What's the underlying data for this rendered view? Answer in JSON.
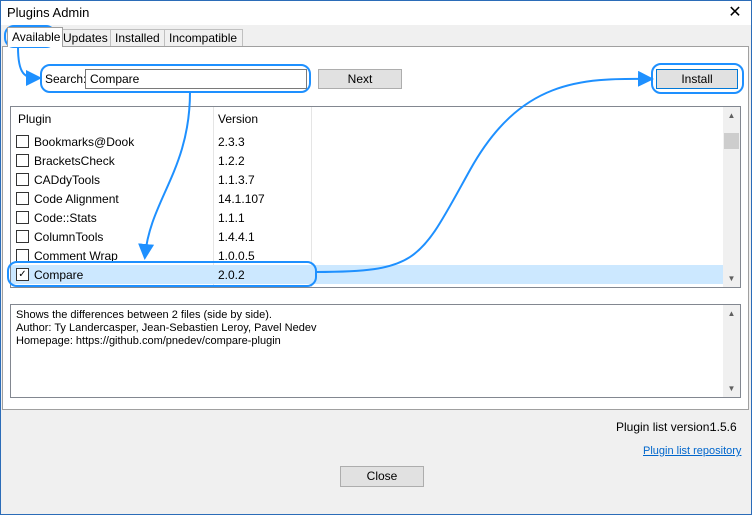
{
  "window": {
    "title": "Plugins Admin"
  },
  "tabs": [
    "Available",
    "Updates",
    "Installed",
    "Incompatible"
  ],
  "search": {
    "label": "Search:",
    "value": "Compare"
  },
  "buttons": {
    "next": "Next",
    "install": "Install",
    "close": "Close"
  },
  "list": {
    "headers": {
      "plugin": "Plugin",
      "version": "Version"
    },
    "rows": [
      {
        "name": "Bookmarks@Dook",
        "version": "2.3.3",
        "checked": false
      },
      {
        "name": "BracketsCheck",
        "version": "1.2.2",
        "checked": false
      },
      {
        "name": "CADdyTools",
        "version": "1.1.3.7",
        "checked": false
      },
      {
        "name": "Code Alignment",
        "version": "14.1.107",
        "checked": false
      },
      {
        "name": "Code::Stats",
        "version": "1.1.1",
        "checked": false
      },
      {
        "name": "ColumnTools",
        "version": "1.4.4.1",
        "checked": false
      },
      {
        "name": "Comment Wrap",
        "version": "1.0.0.5",
        "checked": false
      },
      {
        "name": "Compare",
        "version": "2.0.2",
        "checked": true
      }
    ]
  },
  "description": {
    "line1": "Shows the differences between 2 files (side by side).",
    "line2": "Author: Ty Landercasper, Jean-Sebastien Leroy, Pavel Nedev",
    "line3": "Homepage: https://github.com/pnedev/compare-plugin"
  },
  "footer": {
    "plugin_list_version_label": "Plugin list version:",
    "plugin_list_version": "1.5.6",
    "repo_link": "Plugin list repository"
  },
  "annotation_color": "#1e90ff"
}
